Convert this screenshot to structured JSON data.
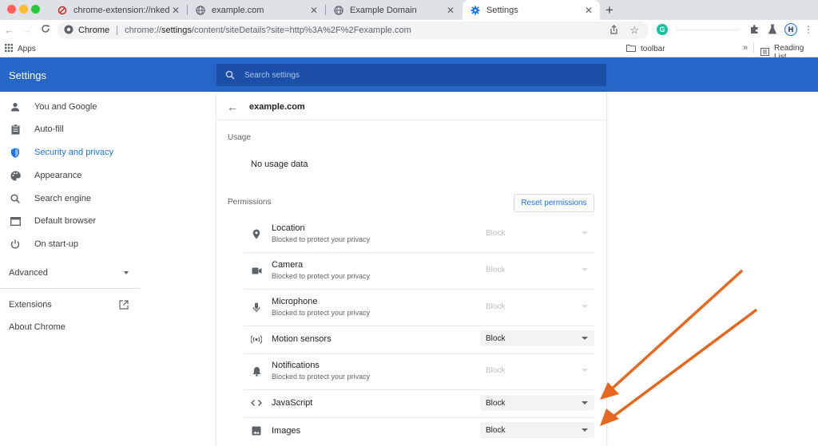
{
  "browser": {
    "tabs": [
      {
        "title": "chrome-extension://nkedbnok",
        "icon": "broken-extension-icon"
      },
      {
        "title": "example.com",
        "icon": "globe-icon"
      },
      {
        "title": "Example Domain",
        "icon": "globe-icon"
      },
      {
        "title": "Settings",
        "icon": "gear-icon",
        "active": true
      }
    ],
    "new_tab": "+",
    "omnibox": {
      "site_label": "Chrome",
      "url_prefix": "chrome://",
      "url_bold": "settings",
      "url_rest": "/content/siteDetails?site=http%3A%2F%2Fexample.com"
    },
    "profile_initial": "H",
    "bookmarks": {
      "apps": "Apps",
      "folder": "toolbar",
      "overflow": "»",
      "reading_list": "Reading List"
    }
  },
  "settings": {
    "title": "Settings",
    "search_placeholder": "Search settings",
    "nav": [
      {
        "label": "You and Google",
        "icon": "person-icon"
      },
      {
        "label": "Auto-fill",
        "icon": "clipboard-icon"
      },
      {
        "label": "Security and privacy",
        "icon": "shield-icon",
        "active": true
      },
      {
        "label": "Appearance",
        "icon": "palette-icon"
      },
      {
        "label": "Search engine",
        "icon": "search-icon"
      },
      {
        "label": "Default browser",
        "icon": "browser-window-icon"
      },
      {
        "label": "On start-up",
        "icon": "power-icon"
      }
    ],
    "advanced": "Advanced",
    "extensions": "Extensions",
    "about": "About Chrome"
  },
  "site": {
    "name": "example.com",
    "usage_heading": "Usage",
    "usage_value": "No usage data",
    "permissions_heading": "Permissions",
    "reset_button": "Reset permissions",
    "permissions": [
      {
        "name": "Location",
        "sub": "Blocked to protect your privacy",
        "value": "Block",
        "disabled": true,
        "icon": "location-pin-icon"
      },
      {
        "name": "Camera",
        "sub": "Blocked to protect your privacy",
        "value": "Block",
        "disabled": true,
        "icon": "camera-icon"
      },
      {
        "name": "Microphone",
        "sub": "Blocked to protect your privacy",
        "value": "Block",
        "disabled": true,
        "icon": "microphone-icon"
      },
      {
        "name": "Motion sensors",
        "sub": "",
        "value": "Block",
        "disabled": false,
        "icon": "motion-sensor-icon"
      },
      {
        "name": "Notifications",
        "sub": "Blocked to protect your privacy",
        "value": "Block",
        "disabled": true,
        "icon": "bell-icon"
      },
      {
        "name": "JavaScript",
        "sub": "",
        "value": "Block",
        "disabled": false,
        "icon": "code-brackets-icon"
      },
      {
        "name": "Images",
        "sub": "",
        "value": "Block",
        "disabled": false,
        "icon": "image-icon"
      }
    ]
  },
  "colors": {
    "accent": "#2566c6",
    "annotation_arrow": "#e8671f"
  }
}
